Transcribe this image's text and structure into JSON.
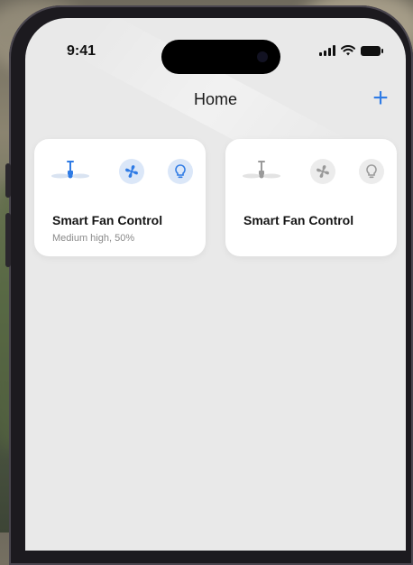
{
  "status": {
    "time": "9:41"
  },
  "header": {
    "title": "Home",
    "add_label": "+"
  },
  "devices": [
    {
      "name": "Smart Fan Control",
      "status": "Medium high, 50%",
      "active": true
    },
    {
      "name": "Smart Fan Control",
      "status": "",
      "active": false
    }
  ],
  "colors": {
    "accent": "#2f7be5",
    "active_bg": "#dbe7f8",
    "inactive_icon": "#9a9a9a"
  },
  "icons": [
    "ceiling-fan-icon",
    "fan-icon",
    "bulb-icon"
  ]
}
